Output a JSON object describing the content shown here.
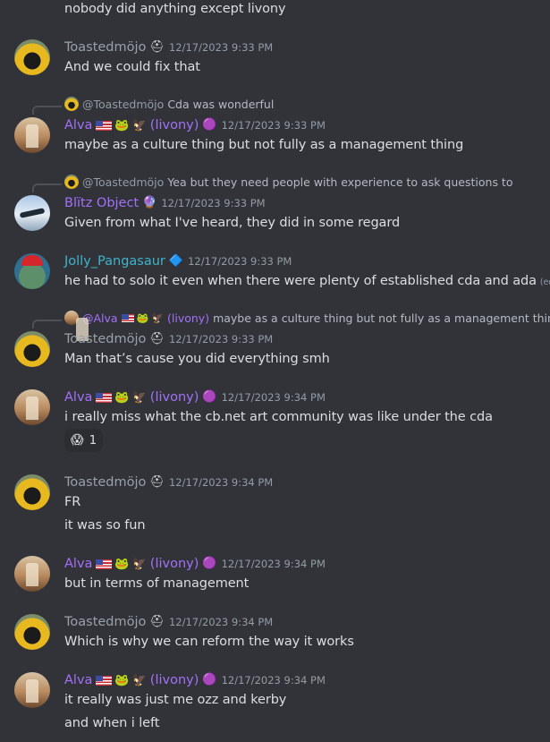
{
  "colors": {
    "background": "#313338",
    "text": "#dbdee1",
    "timestamp": "#949ba4",
    "alva": "#a370f7",
    "jolly": "#3fb3c9",
    "toast": "#9aa0a7"
  },
  "users": {
    "toast": {
      "name": "Toastedmöjo",
      "badge_icon": "helmet-icon"
    },
    "alva": {
      "name": "Alva",
      "suffix": "(livony)",
      "badge_icon": "purple-slime-icon",
      "emoji_icons": [
        "us-flag-icon",
        "green-bird-icon",
        "eagle-icon"
      ]
    },
    "blitz": {
      "name": "Blïtz Object",
      "badge_icon": "purple-orb-icon"
    },
    "jolly": {
      "name": "Jolly_Pangasaur",
      "badge_icon": "blue-badge-icon"
    }
  },
  "messages": [
    {
      "text": "nobody did anything except livony"
    },
    {
      "author": "Toastedmöjo",
      "time": "12/17/2023 9:33 PM",
      "lines": [
        "And we could fix that"
      ]
    },
    {
      "reply_to": "@Toastedmöjo",
      "reply_text": "Cda was wonderful",
      "author": "Alva",
      "time": "12/17/2023 9:33 PM",
      "lines": [
        "maybe as a culture thing but not fully as a management thing"
      ]
    },
    {
      "reply_to": "@Toastedmöjo",
      "reply_text": "Yea but they need people with experience to ask questions to",
      "author": "Blïtz Object",
      "time": "12/17/2023 9:33 PM",
      "lines": [
        "Given from what I've heard, they did in some regard"
      ]
    },
    {
      "author": "Jolly_Pangasaur",
      "time": "12/17/2023 9:33 PM",
      "lines": [
        "he had to solo it even when there were plenty of established cda and ada"
      ],
      "edited": "(edited)"
    },
    {
      "reply_to": "@Alva",
      "reply_suffix": "(livony)",
      "reply_text": "maybe as a culture thing but not fully as a management thing",
      "author": "Toastedmöjo",
      "time": "12/17/2023 9:33 PM",
      "lines": [
        "Man that’s cause you did everything smh"
      ]
    },
    {
      "author": "Alva",
      "time": "12/17/2023 9:34 PM",
      "lines": [
        "i really miss what the cb.net art community was like under the cda"
      ],
      "reaction": {
        "emoji": "😱",
        "count": "1"
      }
    },
    {
      "author": "Toastedmöjo",
      "time": "12/17/2023 9:34 PM",
      "lines": [
        "FR",
        "it was so fun"
      ]
    },
    {
      "author": "Alva",
      "time": "12/17/2023 9:34 PM",
      "lines": [
        "but in terms of management"
      ]
    },
    {
      "author": "Toastedmöjo",
      "time": "12/17/2023 9:34 PM",
      "lines": [
        "Which is why we can reform the way it works"
      ]
    },
    {
      "author": "Alva",
      "time": "12/17/2023 9:34 PM",
      "lines": [
        "it really was just me ozz and kerby",
        "and when i left"
      ]
    }
  ]
}
